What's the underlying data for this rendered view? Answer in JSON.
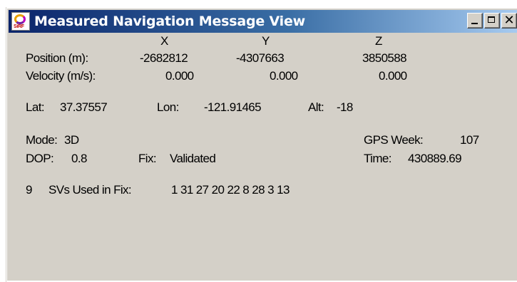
{
  "window": {
    "title": "Measured Navigation Message View",
    "icon_name": "sirf-app-icon",
    "icon_text": "SiRF",
    "buttons": {
      "minimize": "minimize-icon",
      "maximize": "maximize-icon",
      "close": "✕"
    }
  },
  "axes": {
    "x": "X",
    "y": "Y",
    "z": "Z"
  },
  "position": {
    "label": "Position (m):",
    "x": "-2682812",
    "y": "-4307663",
    "z": "3850588"
  },
  "velocity": {
    "label": "Velocity (m/s):",
    "x": "0.000",
    "y": "0.000",
    "z": "0.000"
  },
  "geo": {
    "lat_label": "Lat:",
    "lat": "37.37557",
    "lon_label": "Lon:",
    "lon": "-121.91465",
    "alt_label": "Alt:",
    "alt": "-18"
  },
  "status": {
    "mode_label": "Mode:",
    "mode": "3D",
    "gps_week_label": "GPS Week:",
    "gps_week": "107",
    "dop_label": "DOP:",
    "dop": "0.8",
    "fix_label": "Fix:",
    "fix": "Validated",
    "time_label": "Time:",
    "time": "430889.69"
  },
  "svs": {
    "count": "9",
    "label": "SVs Used in Fix:",
    "list": "1 31 27 20 22 8 28 3 13"
  }
}
